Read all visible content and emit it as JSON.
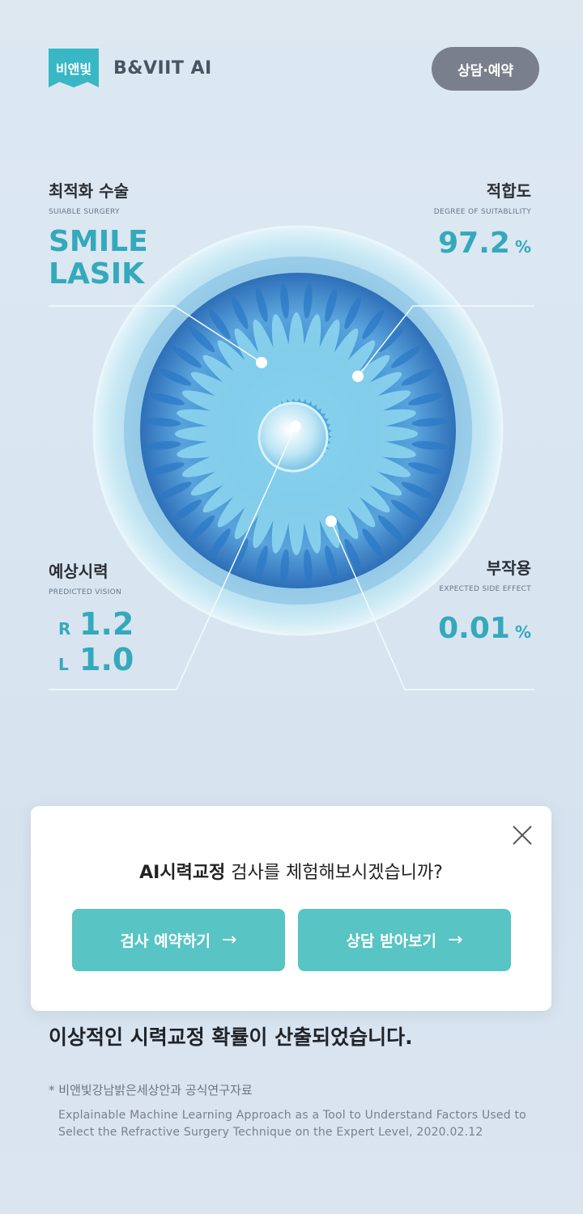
{
  "header": {
    "logo_text": "비앤빛",
    "brand": "B&VIIT AI",
    "consult_button": "상담·예약"
  },
  "stats": {
    "surgery": {
      "title": "최적화 수술",
      "subtitle": "SUIABLE SURGERY",
      "value_line1": "SMILE",
      "value_line2": "LASIK"
    },
    "suitability": {
      "title": "적합도",
      "subtitle": "DEGREE OF SUITABLILITY",
      "value": "97.2",
      "unit": "%"
    },
    "vision": {
      "title": "예상시력",
      "subtitle": "PREDICTED VISION",
      "right_label": "R",
      "right_value": "1.2",
      "left_label": "L",
      "left_value": "1.0"
    },
    "side_effect": {
      "title": "부작용",
      "subtitle": "EXPECTED SIDE EFFECT",
      "value": "0.01",
      "unit": "%"
    }
  },
  "modal": {
    "question_bold": "AI시력교정",
    "question_rest": " 검사를 체험해보시겠습니까?",
    "btn_exam": "검사 예약하기",
    "btn_consult": "상담 받아보기",
    "arrow": "→"
  },
  "footer": {
    "headline": "이상적인 시력교정 확률이 산출되었습니다.",
    "note_title": "* 비앤빛강남밝은세상안과 공식연구자료",
    "note_body": "Explainable Machine Learning Approach as a Tool to Understand Factors Used to Select the Refractive Surgery Technique on the Expert Level, 2020.02.12"
  },
  "colors": {
    "accent": "#34a9bc",
    "button": "#58c4c4",
    "consult": "#7a808b"
  }
}
